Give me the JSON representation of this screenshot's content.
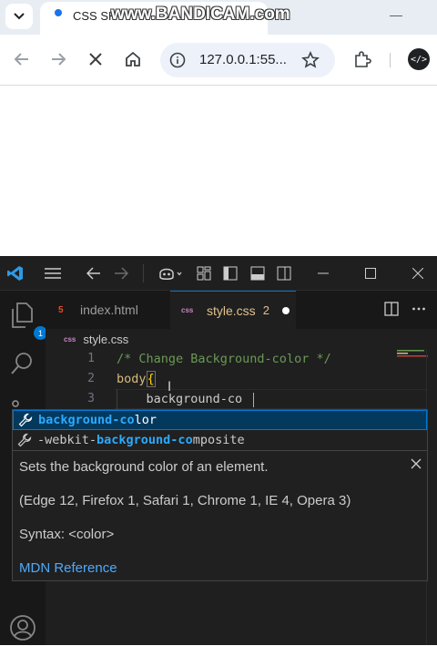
{
  "browser": {
    "tab_title": "CSS SH",
    "watermark": "www.BANDICAM.com",
    "url": "127.0.0.1:55..."
  },
  "vscode": {
    "notification_badge": "1",
    "tabs": [
      {
        "label": "index.html",
        "icon": "html5-icon"
      },
      {
        "label": "style.css",
        "icon": "css-icon",
        "problems": "2",
        "dirty": true
      }
    ],
    "breadcrumb": "style.css",
    "editor": {
      "lines": [
        {
          "number": "1",
          "text": "/* Change Background-color */"
        },
        {
          "number": "2",
          "selector": "body",
          "brace": "{"
        },
        {
          "number": "3",
          "text": "    background-co"
        }
      ]
    },
    "suggestions": [
      {
        "match": "background-co",
        "rest": "lor",
        "prefix": ""
      },
      {
        "prefix": "-webkit-",
        "match": "background-co",
        "rest": "mposite"
      }
    ],
    "details": {
      "description": "Sets the background color of an element.",
      "browsers": "(Edge 12, Firefox 1, Safari 1, Chrome 1, IE 4, Opera 3)",
      "syntax": "Syntax: <color>",
      "reference": "MDN Reference"
    },
    "colors": {
      "accent": "#0078d4",
      "comment": "#6a9955",
      "selector": "#d7ba7d",
      "match": "#2aaaff",
      "link": "#4daafc"
    }
  }
}
